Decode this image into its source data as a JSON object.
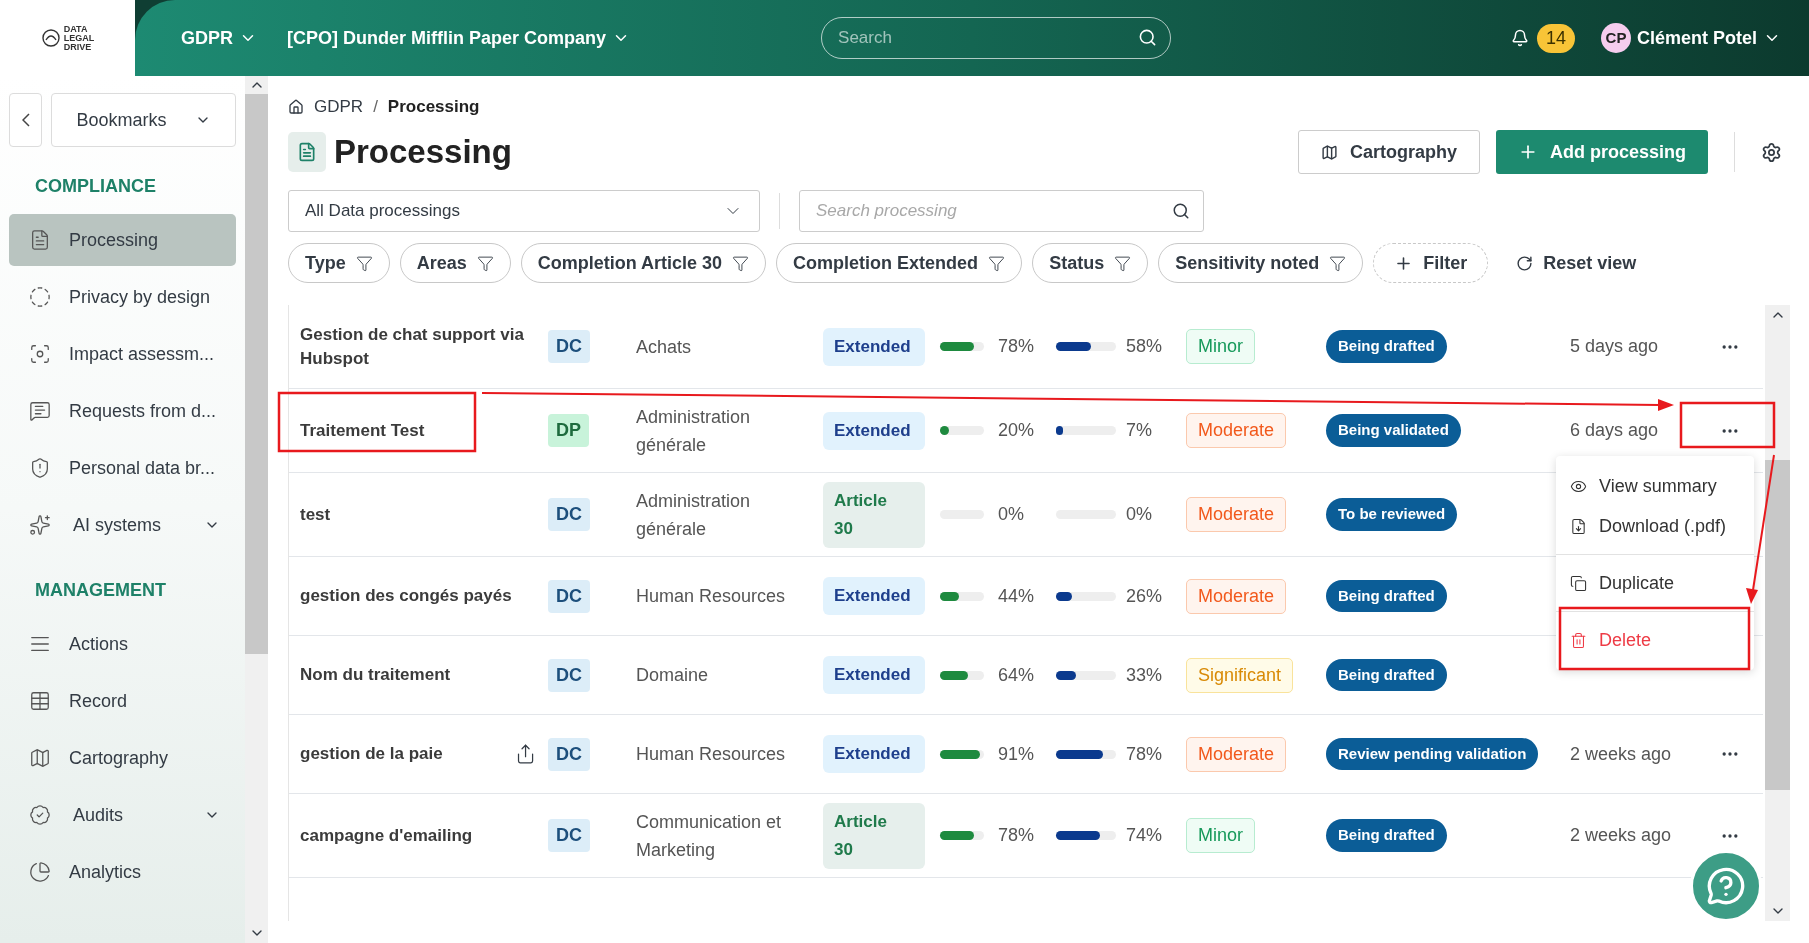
{
  "topbar": {
    "logo_text": [
      "DATA",
      "LEGAL",
      "DRIVE"
    ],
    "module": "GDPR",
    "organization": "[CPO] Dunder Mifflin Paper Company",
    "search": {
      "placeholder": "Search"
    },
    "notifications": "14",
    "user": {
      "initials": "CP",
      "name": "Clément Potel"
    }
  },
  "sidebar": {
    "bookmarks": "Bookmarks",
    "sections": [
      {
        "title": "COMPLIANCE",
        "items": [
          {
            "label": "Processing",
            "selected": true,
            "expandable": false
          },
          {
            "label": "Privacy by design",
            "selected": false,
            "expandable": false
          },
          {
            "label": "Impact assessm...",
            "selected": false,
            "expandable": false
          },
          {
            "label": "Requests from d...",
            "selected": false,
            "expandable": false
          },
          {
            "label": "Personal data br...",
            "selected": false,
            "expandable": false
          },
          {
            "label": "AI systems",
            "selected": false,
            "expandable": true
          }
        ]
      },
      {
        "title": "MANAGEMENT",
        "items": [
          {
            "label": "Actions",
            "selected": false,
            "expandable": false
          },
          {
            "label": "Record",
            "selected": false,
            "expandable": false
          },
          {
            "label": "Cartography",
            "selected": false,
            "expandable": false
          },
          {
            "label": "Audits",
            "selected": false,
            "expandable": true
          },
          {
            "label": "Analytics",
            "selected": false,
            "expandable": false
          }
        ]
      }
    ]
  },
  "breadcrumb": [
    "GDPR",
    "Processing"
  ],
  "breadcrumb_separator": "/",
  "page_title": "Processing",
  "header_buttons": {
    "cartography": "Cartography",
    "add": "Add processing"
  },
  "view_select": "All Data processings",
  "search": {
    "placeholder": "Search processing"
  },
  "filter_chips": [
    "Type",
    "Areas",
    "Completion Article 30",
    "Completion Extended",
    "Status",
    "Sensitivity noted"
  ],
  "add_filter": "Filter",
  "reset_view": "Reset view",
  "rows": [
    {
      "name": "Gestion de chat support via Hubspot",
      "shared": false,
      "role": {
        "text": "DC",
        "kind": "controller"
      },
      "area": "Achats",
      "type": {
        "text": "Extended",
        "kind": "extended"
      },
      "completion_article30": {
        "level": 0.78,
        "reading": "78%"
      },
      "completion_extended": {
        "level": 0.58,
        "reading": "58%"
      },
      "sensitivity": {
        "text": "Minor",
        "kind": "minor"
      },
      "status": "Being drafted",
      "updated": "5 days ago"
    },
    {
      "name": "Traitement Test",
      "shared": false,
      "role": {
        "text": "DP",
        "kind": "processor"
      },
      "area": "Administration générale",
      "type": {
        "text": "Extended",
        "kind": "extended"
      },
      "completion_article30": {
        "level": 0.2,
        "reading": "20%"
      },
      "completion_extended": {
        "level": 0.07,
        "reading": "7%"
      },
      "sensitivity": {
        "text": "Moderate",
        "kind": "moderate"
      },
      "status": "Being validated",
      "updated": "6 days ago"
    },
    {
      "name": "test",
      "shared": false,
      "role": {
        "text": "DC",
        "kind": "controller"
      },
      "area": "Administration générale",
      "type": {
        "text": "Article 30",
        "kind": "article30"
      },
      "completion_article30": {
        "level": 0,
        "reading": "0%"
      },
      "completion_extended": {
        "level": 0,
        "reading": "0%"
      },
      "sensitivity": {
        "text": "Moderate",
        "kind": "moderate"
      },
      "status": "To be reviewed"
    },
    {
      "name": "gestion des congés payés",
      "shared": false,
      "role": {
        "text": "DC",
        "kind": "controller"
      },
      "area": "Human Resources",
      "type": {
        "text": "Extended",
        "kind": "extended"
      },
      "completion_article30": {
        "level": 0.44,
        "reading": "44%"
      },
      "completion_extended": {
        "level": 0.26,
        "reading": "26%"
      },
      "sensitivity": {
        "text": "Moderate",
        "kind": "moderate"
      },
      "status": "Being drafted"
    },
    {
      "name": "Nom du traitement",
      "shared": false,
      "role": {
        "text": "DC",
        "kind": "controller"
      },
      "area": "Domaine",
      "type": {
        "text": "Extended",
        "kind": "extended"
      },
      "completion_article30": {
        "level": 0.64,
        "reading": "64%"
      },
      "completion_extended": {
        "level": 0.33,
        "reading": "33%"
      },
      "sensitivity": {
        "text": "Significant",
        "kind": "significant"
      },
      "status": "Being drafted"
    },
    {
      "name": "gestion de la paie",
      "shared": true,
      "role": {
        "text": "DC",
        "kind": "controller"
      },
      "area": "Human Resources",
      "type": {
        "text": "Extended",
        "kind": "extended"
      },
      "completion_article30": {
        "level": 0.91,
        "reading": "91%"
      },
      "completion_extended": {
        "level": 0.78,
        "reading": "78%"
      },
      "sensitivity": {
        "text": "Moderate",
        "kind": "moderate"
      },
      "status": "Review pending validation",
      "updated": "2 weeks ago"
    },
    {
      "name": "campagne d'emailing",
      "shared": false,
      "role": {
        "text": "DC",
        "kind": "controller"
      },
      "area": "Communication et Marketing",
      "type": {
        "text": "Article 30",
        "kind": "article30"
      },
      "completion_article30": {
        "level": 0.78,
        "reading": "78%"
      },
      "completion_extended": {
        "level": 0.74,
        "reading": "74%"
      },
      "sensitivity": {
        "text": "Minor",
        "kind": "minor"
      },
      "status": "Being drafted",
      "updated": "2 weeks ago"
    }
  ],
  "row_menu": {
    "items": [
      {
        "label": "View summary",
        "kind": "normal"
      },
      {
        "label": "Download (.pdf)",
        "kind": "normal"
      },
      {
        "label": "Duplicate",
        "kind": "normal"
      },
      {
        "label": "Delete",
        "kind": "danger"
      }
    ]
  }
}
